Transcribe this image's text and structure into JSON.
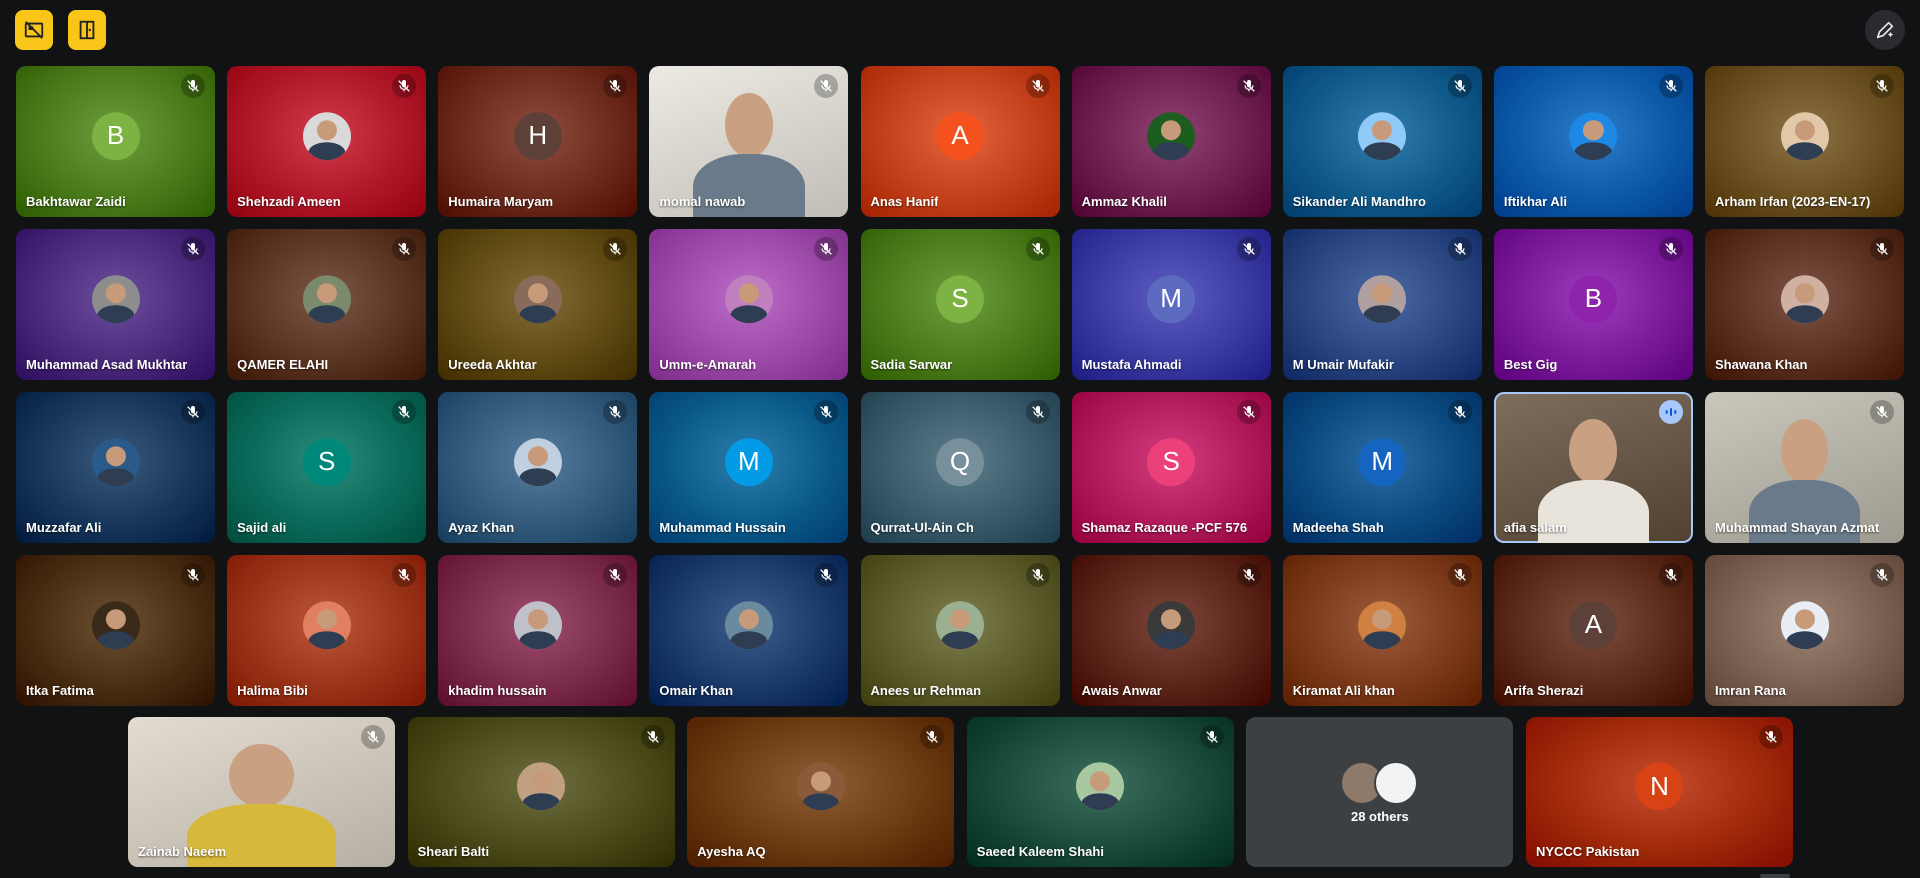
{
  "toolbar": {
    "left_buttons": [
      {
        "icon": "no-video-layout-icon"
      },
      {
        "icon": "door-exit-icon"
      }
    ],
    "right_button_icon": "edit-pen-icon"
  },
  "participants": [
    {
      "name": "Bakhtawar Zaidi",
      "initial": "B",
      "bg": "#4a7a1a",
      "avatar_color": "#7cb342",
      "type": "initial",
      "muted": true
    },
    {
      "name": "Shehzadi Ameen",
      "initial": "",
      "bg": "#b0182a",
      "avatar_color": "#d9d9d9",
      "type": "photo",
      "muted": true
    },
    {
      "name": "Humaira Maryam",
      "initial": "H",
      "bg": "#6b2a1c",
      "avatar_color": "#5d4037",
      "type": "initial",
      "muted": true
    },
    {
      "name": "momal nawab",
      "initial": "",
      "bg": "#d9d6d0",
      "avatar_color": "",
      "type": "video",
      "muted": true
    },
    {
      "name": "Anas Hanif",
      "initial": "A",
      "bg": "#c2401a",
      "avatar_color": "#f4511e",
      "type": "initial",
      "muted": true
    },
    {
      "name": "Ammaz Khalil",
      "initial": "",
      "bg": "#6d1f4f",
      "avatar_color": "#1b5e20",
      "type": "photo",
      "muted": true
    },
    {
      "name": "Sikander Ali Mandhro",
      "initial": "",
      "bg": "#0f5a8a",
      "avatar_color": "#90caf9",
      "type": "photo",
      "muted": true
    },
    {
      "name": "Iftikhar Ali",
      "initial": "",
      "bg": "#0b5aa8",
      "avatar_color": "#1e88e5",
      "type": "photo",
      "muted": true
    },
    {
      "name": "Arham Irfan (2023-EN-17)",
      "initial": "",
      "bg": "#6a5020",
      "avatar_color": "#e0c8a8",
      "type": "photo",
      "muted": true
    },
    {
      "name": "Muhammad Asad Mukhtar",
      "initial": "",
      "bg": "#4a2a7a",
      "avatar_color": "#8d8d8d",
      "type": "photo",
      "muted": true
    },
    {
      "name": "QAMER ELAHI",
      "initial": "",
      "bg": "#5a3422",
      "avatar_color": "#7a8a6a",
      "type": "photo",
      "muted": true
    },
    {
      "name": "Ureeda Akhtar",
      "initial": "",
      "bg": "#5e4a12",
      "avatar_color": "#8a6a5a",
      "type": "photo",
      "muted": true
    },
    {
      "name": "Umm-e-Amarah",
      "initial": "",
      "bg": "#9a4aa6",
      "avatar_color": "#c080c0",
      "type": "photo",
      "muted": true
    },
    {
      "name": "Sadia Sarwar",
      "initial": "S",
      "bg": "#4a7a1a",
      "avatar_color": "#7cb342",
      "type": "initial",
      "muted": true
    },
    {
      "name": "Mustafa Ahmadi",
      "initial": "M",
      "bg": "#3a3aa0",
      "avatar_color": "#5c6bc0",
      "type": "initial",
      "muted": true
    },
    {
      "name": "M Umair Mufakir",
      "initial": "",
      "bg": "#2a4680",
      "avatar_color": "#b0a0a0",
      "type": "photo",
      "muted": true
    },
    {
      "name": "Best Gig",
      "initial": "B",
      "bg": "#7a1a9a",
      "avatar_color": "#8e24aa",
      "type": "initial",
      "muted": true
    },
    {
      "name": "Shawana Khan",
      "initial": "",
      "bg": "#5a3020",
      "avatar_color": "#d0b0a0",
      "type": "photo",
      "muted": true
    },
    {
      "name": "Muzzafar Ali",
      "initial": "",
      "bg": "#17375a",
      "avatar_color": "#2a5a8a",
      "type": "photo",
      "muted": true
    },
    {
      "name": "Sajid ali",
      "initial": "S",
      "bg": "#0a6a5a",
      "avatar_color": "#00897b",
      "type": "initial",
      "muted": true
    },
    {
      "name": "Ayaz Khan",
      "initial": "",
      "bg": "#335a7a",
      "avatar_color": "#c0d0e0",
      "type": "photo",
      "muted": true
    },
    {
      "name": "Muhammad Hussain",
      "initial": "M",
      "bg": "#0a5a8a",
      "avatar_color": "#039be5",
      "type": "initial",
      "muted": true
    },
    {
      "name": "Qurrat-Ul-Ain Ch",
      "initial": "Q",
      "bg": "#3a5a6a",
      "avatar_color": "#78909c",
      "type": "initial",
      "muted": true
    },
    {
      "name": "Shamaz Razaque -PCF 576",
      "initial": "S",
      "bg": "#b01a5a",
      "avatar_color": "#ec407a",
      "type": "initial",
      "muted": true
    },
    {
      "name": "Madeeha Shah",
      "initial": "M",
      "bg": "#0a4a80",
      "avatar_color": "#1565c0",
      "type": "initial",
      "muted": true
    },
    {
      "name": "afia salam",
      "initial": "",
      "bg": "#6a5a4a",
      "avatar_color": "",
      "type": "video",
      "muted": false,
      "speaking": true
    },
    {
      "name": "Muhammad Shayan Azmat",
      "initial": "",
      "bg": "#b6b4a8",
      "avatar_color": "",
      "type": "video",
      "muted": true
    },
    {
      "name": "Itka Fatima",
      "initial": "",
      "bg": "#4a2e12",
      "avatar_color": "#3a2a1a",
      "type": "photo",
      "muted": true
    },
    {
      "name": "Halima Bibi",
      "initial": "",
      "bg": "#9a3418",
      "avatar_color": "#e08060",
      "type": "photo",
      "muted": true
    },
    {
      "name": "khadim hussain",
      "initial": "",
      "bg": "#7a2a4a",
      "avatar_color": "#c0c0c8",
      "type": "photo",
      "muted": true
    },
    {
      "name": "Omair Khan",
      "initial": "",
      "bg": "#1a3a6a",
      "avatar_color": "#6a8aa0",
      "type": "photo",
      "muted": true
    },
    {
      "name": "Anees ur Rehman",
      "initial": "",
      "bg": "#5a5a2a",
      "avatar_color": "#9ab090",
      "type": "photo",
      "muted": true
    },
    {
      "name": "Awais Anwar",
      "initial": "",
      "bg": "#5a2418",
      "avatar_color": "#3a3a3a",
      "type": "photo",
      "muted": true
    },
    {
      "name": "Kiramat Ali khan",
      "initial": "",
      "bg": "#7a3a1a",
      "avatar_color": "#d08040",
      "type": "photo",
      "muted": true
    },
    {
      "name": "Arifa Sherazi",
      "initial": "A",
      "bg": "#5a2a1a",
      "avatar_color": "#5d4037",
      "type": "initial",
      "muted": true
    },
    {
      "name": "Imran Rana",
      "initial": "",
      "bg": "#7a6050",
      "avatar_color": "#e8eef4",
      "type": "photo",
      "muted": true
    }
  ],
  "last_row": [
    {
      "name": "Zainab Naeem",
      "initial": "",
      "bg": "#cfc8bc",
      "avatar_color": "",
      "type": "video",
      "muted": true
    },
    {
      "name": "Sheari Balti",
      "initial": "",
      "bg": "#4a4a1a",
      "avatar_color": "#c0a080",
      "type": "photo",
      "muted": true
    },
    {
      "name": "Ayesha AQ",
      "initial": "",
      "bg": "#6a3a10",
      "avatar_color": "#8a5a3a",
      "type": "photo",
      "muted": true
    },
    {
      "name": "Saeed Kaleem Shahi",
      "initial": "",
      "bg": "#1a4a3a",
      "avatar_color": "#a8c8a0",
      "type": "photo",
      "muted": true
    },
    {
      "name": "",
      "others_label": "28 others",
      "type": "others",
      "bg": "#3c4043"
    },
    {
      "name": "NYCCC Pakistan",
      "initial": "N",
      "bg": "#a02a0a",
      "avatar_color": "#d84315",
      "type": "initial",
      "muted": true
    }
  ]
}
